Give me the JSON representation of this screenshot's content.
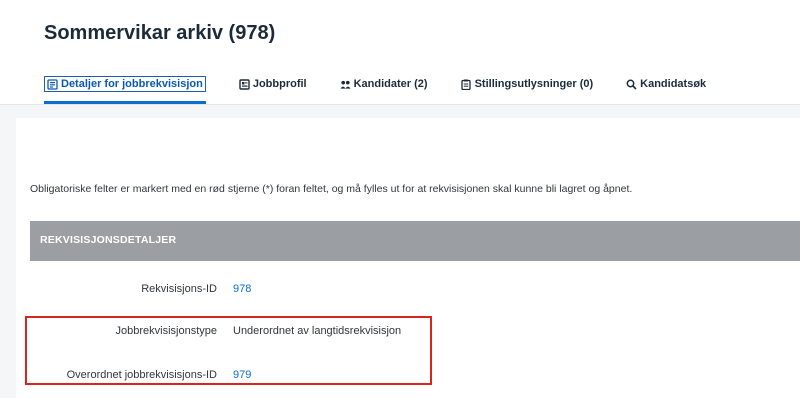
{
  "header": {
    "title": "Sommervikar arkiv (978)",
    "tabs": [
      {
        "label": "Detaljer for jobbrekvisisjon",
        "icon": "details-icon",
        "active": true
      },
      {
        "label": "Jobbprofil",
        "icon": "profile-icon",
        "active": false
      },
      {
        "label": "Kandidater (2)",
        "icon": "candidates-icon",
        "active": false
      },
      {
        "label": "Stillingsutlysninger (0)",
        "icon": "clipboard-icon",
        "active": false
      },
      {
        "label": "Kandidatsøk",
        "icon": "search-icon",
        "active": false
      }
    ]
  },
  "main": {
    "notice": "Obligatoriske felter er markert med en rød stjerne (*) foran feltet, og må fylles ut for at rekvisisjonen skal kunne bli lagret og åpnet.",
    "section_title": "REKVISISJONSDETALJER",
    "fields": [
      {
        "label": "Rekvisisjons-ID",
        "value": "978"
      },
      {
        "label": "Jobbrekvisisjonstype",
        "value": "Underordnet av langtidsrekvisisjon"
      },
      {
        "label": "Overordnet jobbrekvisisjons-ID",
        "value": "979"
      }
    ]
  },
  "colors": {
    "accent": "#0a6ed1",
    "section_bar": "#9b9fa3",
    "highlight": "#d9251d"
  }
}
